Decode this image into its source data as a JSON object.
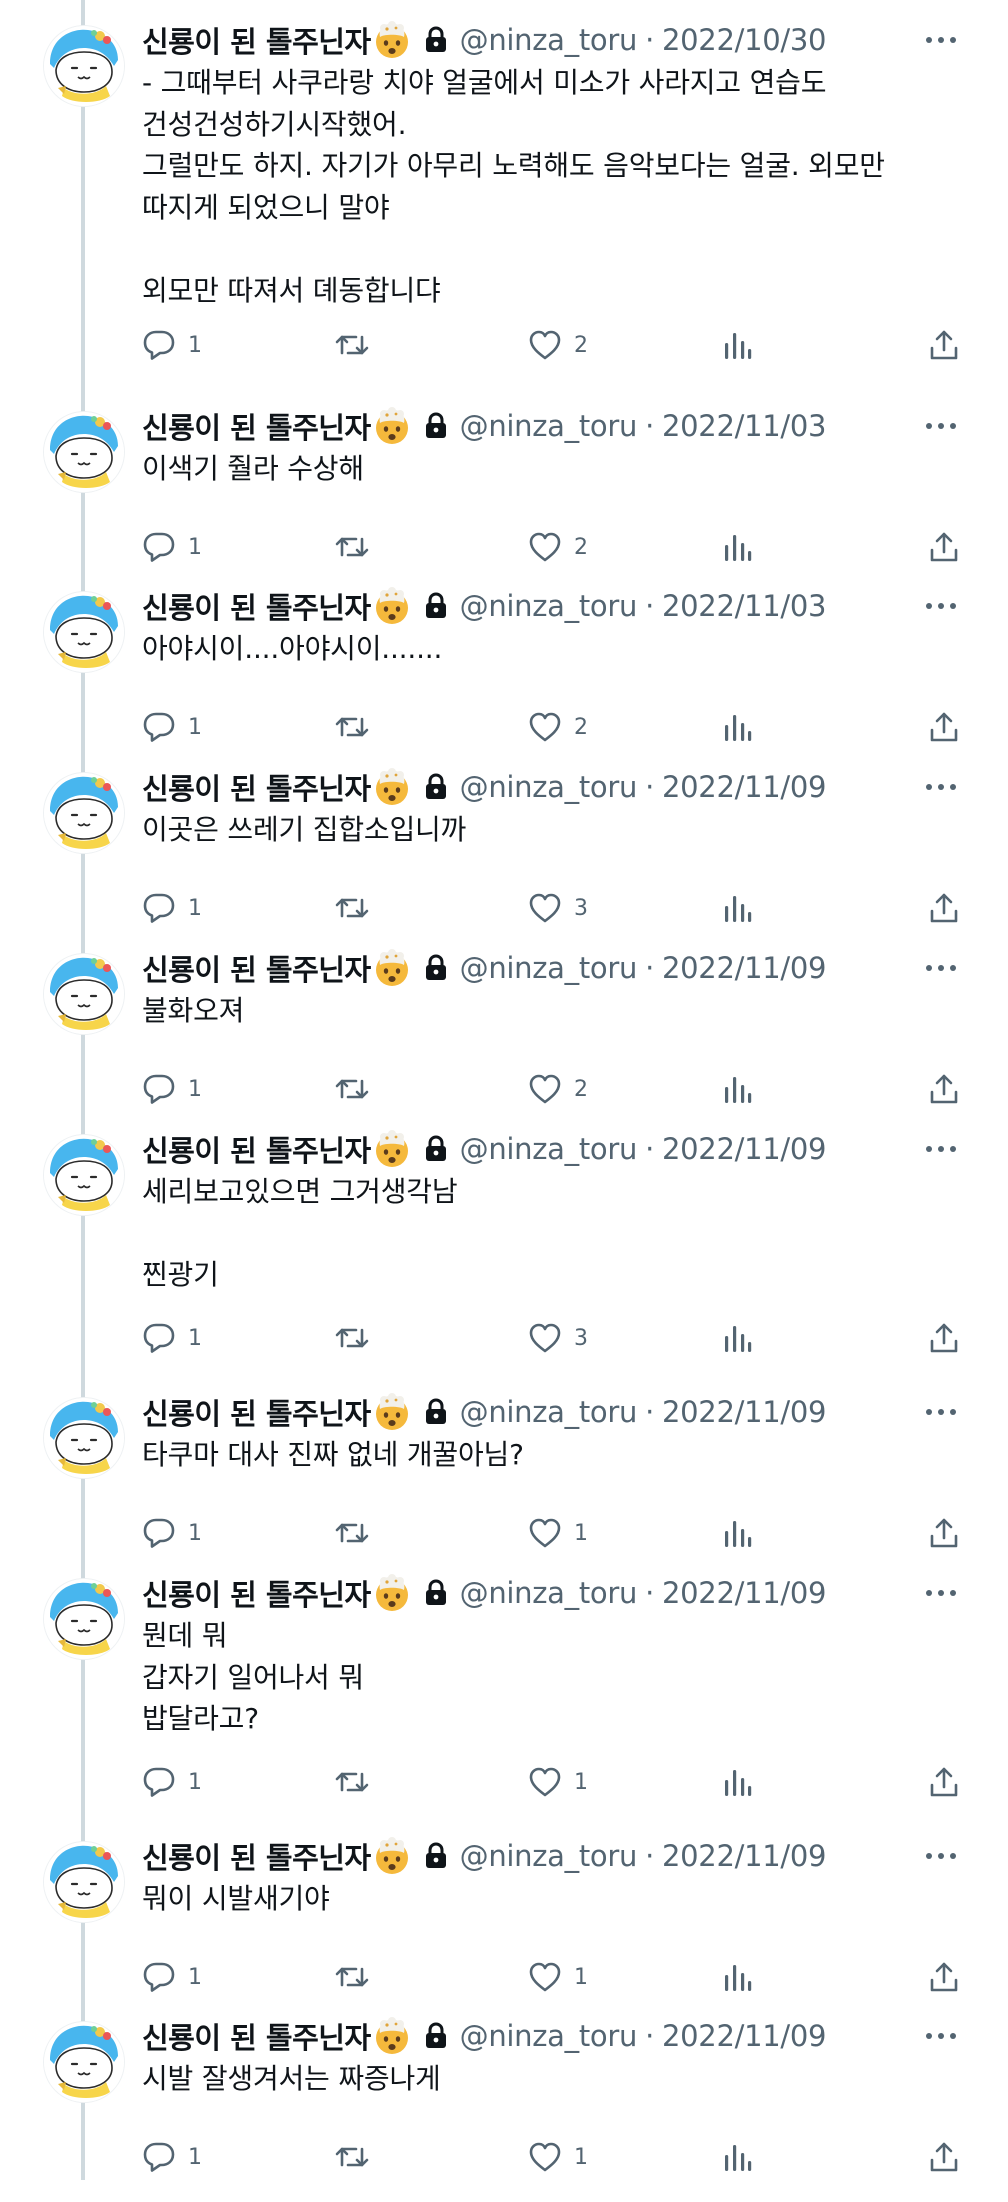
{
  "user": {
    "display_name": "신룡이 된 톨주닌자",
    "emoji": "exploding-head-emoji",
    "handle": "@ninza_toru",
    "protected_icon": "lock-icon"
  },
  "separator": "·",
  "icons": {
    "reply": "reply-icon",
    "retweet": "retweet-icon",
    "like": "heart-icon",
    "views": "views-chart-icon",
    "share": "share-icon",
    "more": "more-icon"
  },
  "colors": {
    "text": "#0f1419",
    "secondary": "#536471",
    "thread_line": "#cfd9de",
    "avatar_accent": "#48b6ee"
  },
  "tweets": [
    {
      "date": "2022/10/30",
      "text": "- 그때부터 사쿠라랑 치야 얼굴에서 미소가 사라지고 연습도 건성건성하기시작했어.\n그럴만도 하지. 자기가 아무리 노력해도 음악보다는 얼굴. 외모만 따지게 되었으니 말야\n\n외모만 따져서 뎨동합니댜",
      "replies": "1",
      "likes": "2"
    },
    {
      "date": "2022/11/03",
      "text": "이색기 줠라 수상해",
      "replies": "1",
      "likes": "2"
    },
    {
      "date": "2022/11/03",
      "text": "아야시이....아야시이.......",
      "replies": "1",
      "likes": "2"
    },
    {
      "date": "2022/11/09",
      "text": "이곳은 쓰레기 집합소입니까",
      "replies": "1",
      "likes": "3"
    },
    {
      "date": "2022/11/09",
      "text": "불화오져",
      "replies": "1",
      "likes": "2"
    },
    {
      "date": "2022/11/09",
      "text": "세리보고있으면 그거생각남\n\n찐광기",
      "replies": "1",
      "likes": "3"
    },
    {
      "date": "2022/11/09",
      "text": "타쿠마 대사 진짜 없네 개꿀아님?",
      "replies": "1",
      "likes": "1"
    },
    {
      "date": "2022/11/09",
      "text": "뭔데 뭐\n갑자기 일어나서 뭐\n밥달라고?",
      "replies": "1",
      "likes": "1"
    },
    {
      "date": "2022/11/09",
      "text": "뭐이 시발새기야",
      "replies": "1",
      "likes": "1"
    },
    {
      "date": "2022/11/09",
      "text": "시발 잘생겨서는 짜증나게",
      "replies": "1",
      "likes": "1"
    }
  ]
}
